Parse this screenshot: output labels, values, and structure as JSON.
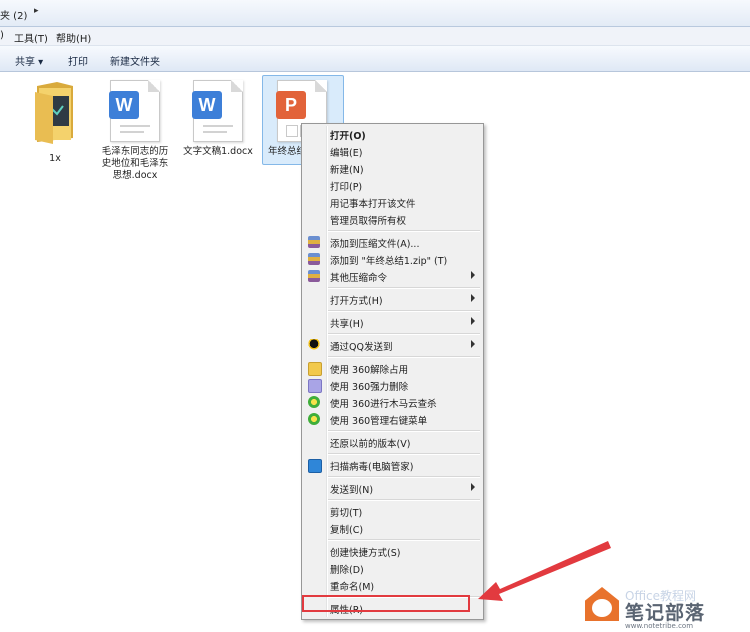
{
  "address": {
    "text": "夹 (2)"
  },
  "menubar": {
    "tools": "工具(T)",
    "help": "帮助(H)"
  },
  "toolbar": {
    "share": "共享 ▾",
    "print": "打印",
    "new_folder": "新建文件夹"
  },
  "files": [
    {
      "name": "1x",
      "type": "folder"
    },
    {
      "name": "毛泽东同志的历史地位和毛泽东思想.docx",
      "type": "word",
      "badge": "W",
      "lines": [
        "毛泽东同志的历",
        "史地位和毛泽东",
        "思想.docx"
      ]
    },
    {
      "name": "文字文稿1.docx",
      "type": "word",
      "badge": "W",
      "lines": [
        "文字文稿1.docx"
      ]
    },
    {
      "name": "年终总结",
      "type": "ppt",
      "badge": "P",
      "lines": [
        "年终总结"
      ]
    }
  ],
  "context_menu": {
    "items": [
      {
        "label": "打开(O)"
      },
      {
        "label": "编辑(E)"
      },
      {
        "label": "新建(N)"
      },
      {
        "label": "打印(P)"
      },
      {
        "label": "用记事本打开该文件"
      },
      {
        "label": "管理员取得所有权"
      },
      {
        "label": "添加到压缩文件(A)..."
      },
      {
        "label": "添加到 \"年终总结1.zip\" (T)"
      },
      {
        "label": "其他压缩命令"
      },
      {
        "label": "打开方式(H)"
      },
      {
        "label": "共享(H)"
      },
      {
        "label": "通过QQ发送到"
      },
      {
        "label": "使用 360解除占用"
      },
      {
        "label": "使用 360强力删除"
      },
      {
        "label": "使用 360进行木马云查杀"
      },
      {
        "label": "使用 360管理右键菜单"
      },
      {
        "label": "还原以前的版本(V)"
      },
      {
        "label": "扫描病毒(电脑管家)"
      },
      {
        "label": "发送到(N)"
      },
      {
        "label": "剪切(T)"
      },
      {
        "label": "复制(C)"
      },
      {
        "label": "创建快捷方式(S)"
      },
      {
        "label": "删除(D)"
      },
      {
        "label": "重命名(M)"
      },
      {
        "label": "属性(R)"
      }
    ]
  },
  "watermark": {
    "title": "笔记部落",
    "url": "www.notetribe.com",
    "faded": "Office教程网"
  },
  "colors": {
    "word": "#3d7fd8",
    "ppt": "#e2633a",
    "folder": "#e8c45a",
    "highlight": "#e23a3f"
  }
}
